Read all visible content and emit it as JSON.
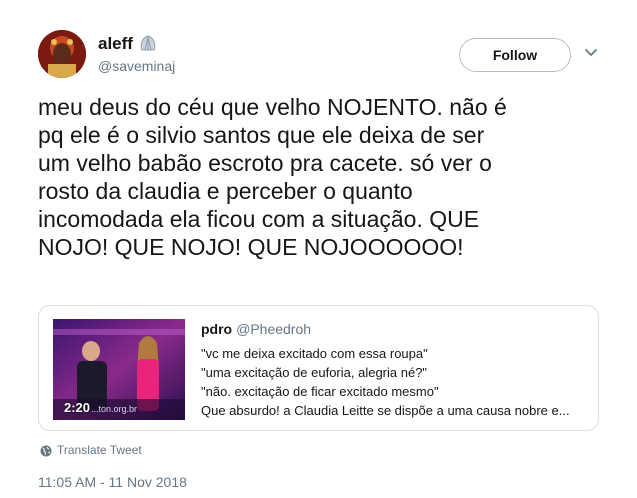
{
  "author": {
    "display_name": "aleff",
    "handle": "@saveminaj",
    "badge_icon": "seashell-emoji-icon",
    "avatar_icon": "profile-avatar"
  },
  "follow": {
    "label": "Follow"
  },
  "menu": {
    "icon": "chevron-down-icon"
  },
  "tweet": {
    "text": "meu deus do céu que velho NOJENTO. não é\npq ele é o silvio santos que ele deixa de ser\num velho babão escroto pra cacete. só ver o\nrosto da claudia e perceber o quanto\nincomodada ela ficou com a situação. QUE\nNOJO! QUE NOJO! QUE NOJOOOOOO!"
  },
  "quoted": {
    "name": "pdro",
    "handle": "@Pheedroh",
    "lines": [
      "\"vc me deixa excitado com essa roupa\"",
      "\"uma excitação de euforia, alegria né?\"",
      "\"não. excitação de ficar excitado mesmo\"",
      "Que absurdo! a Claudia Leitte se dispõe a uma causa nobre e..."
    ],
    "video": {
      "duration": "2:20",
      "overlay_text": "...ton.org.br"
    }
  },
  "translate": {
    "label": "Translate Tweet",
    "icon": "globe-icon"
  },
  "timestamp": "11:05 AM - 11 Nov 2018",
  "colors": {
    "text_primary": "#14171a",
    "text_secondary": "#657786",
    "border": "#d7dde2"
  }
}
